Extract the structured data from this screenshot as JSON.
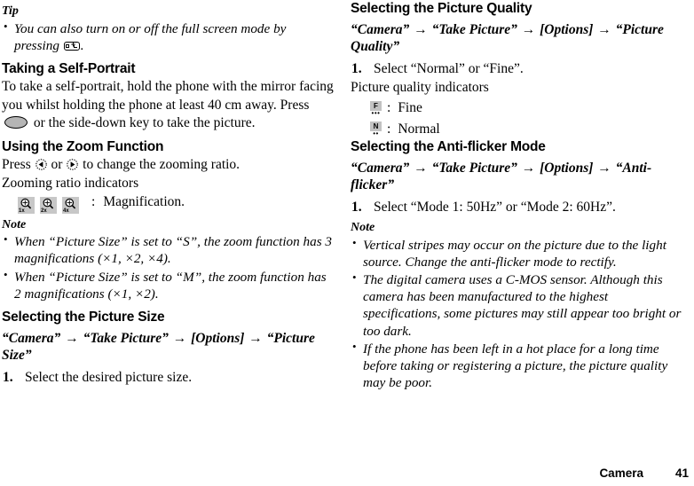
{
  "left_column": {
    "tip_heading": "Tip",
    "tip_bullet_part1": "You can also turn on or off the full screen mode by pressing",
    "tip_bullet_part2": ".",
    "self_portrait": {
      "heading": "Taking a Self-Portrait",
      "body_part1": "To take a self-portrait, hold the phone with the mirror facing you whilst holding the phone at least 40 cm away. Press",
      "body_part2": "or the side-down key to take the picture."
    },
    "zoom_function": {
      "heading": "Using the Zoom Function",
      "press_part1": "Press",
      "press_or": "or",
      "press_part2": "to change the zooming ratio.",
      "indicators_label": "Zooming ratio indicators",
      "magnifications": [
        "1x",
        "2x",
        "4x"
      ],
      "magnification_colon": ":",
      "magnification_label": "Magnification."
    },
    "note_heading": "Note",
    "notes": [
      "When “Picture Size” is set to “S”, the zoom function has 3 magnifications (×1, ×2, ×4).",
      "When “Picture Size” is set to “M”, the zoom function has 2 magnifications (×1, ×2)."
    ],
    "picture_size": {
      "heading": "Selecting the Picture Size",
      "path": [
        "“Camera”",
        "“Take Picture”",
        "[Options]",
        "“Picture Size”"
      ],
      "steps": [
        "Select the desired picture size."
      ]
    }
  },
  "right_column": {
    "picture_quality": {
      "heading": "Selecting the Picture Quality",
      "path": [
        "“Camera”",
        "“Take Picture”",
        "[Options]",
        "“Picture Quality”"
      ],
      "steps": [
        "Select “Normal” or “Fine”."
      ],
      "indicators_label": "Picture quality indicators",
      "indicators": [
        {
          "glyph": "F",
          "dots": "•••",
          "colon": ":",
          "label": "Fine"
        },
        {
          "glyph": "N",
          "dots": "••",
          "colon": ":",
          "label": "Normal"
        }
      ]
    },
    "anti_flicker": {
      "heading": "Selecting the Anti-flicker Mode",
      "path": [
        "“Camera”",
        "“Take Picture”",
        "[Options]",
        "“Anti-flicker”"
      ],
      "steps": [
        "Select “Mode 1: 50Hz” or “Mode 2: 60Hz”."
      ],
      "note_heading": "Note",
      "notes": [
        "Vertical stripes may occur on the picture due to the light source. Change the anti-flicker mode to rectify.",
        "The digital camera uses a C-MOS sensor. Although this camera has been manufactured to the highest specifications, some pictures may still appear too bright or too dark.",
        "If the phone has been left in a hot place for a long time before taking or registering a picture, the picture quality may be poor."
      ]
    }
  },
  "footer": {
    "chapter": "Camera",
    "page_number": "41"
  },
  "arrow_symbol": "→",
  "colors": {
    "text": "#000000",
    "background": "#ffffff",
    "icon_gray": "#c2c2c2",
    "key_gray": "#b5b5b5"
  }
}
